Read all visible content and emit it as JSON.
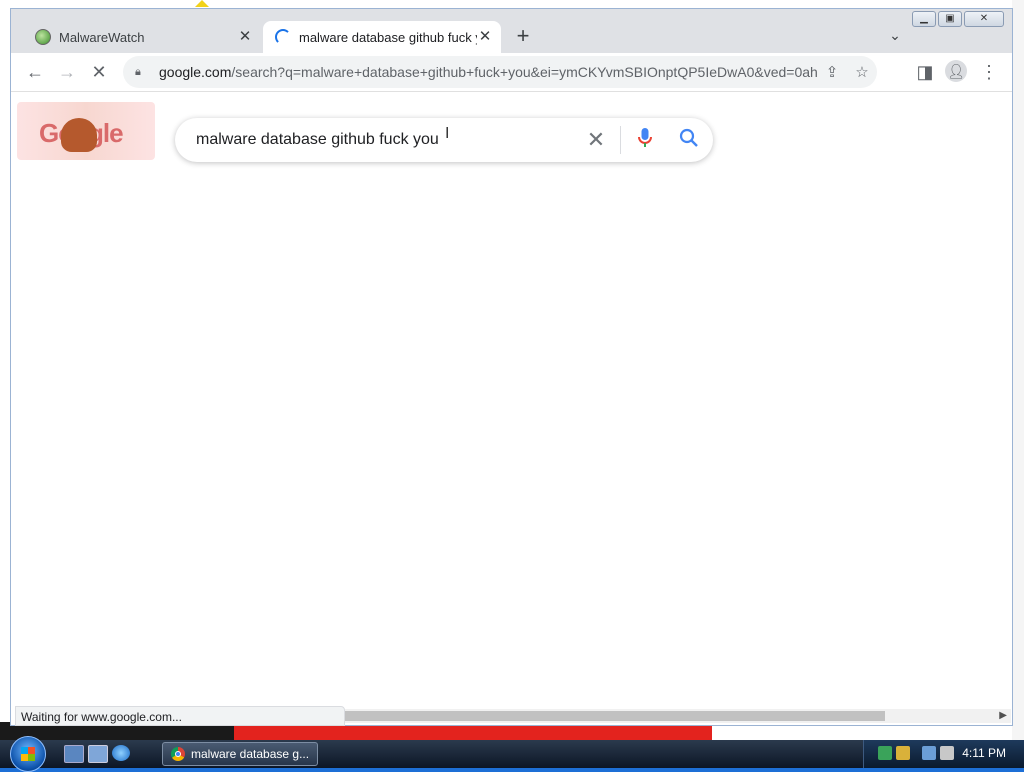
{
  "window": {
    "tabs": [
      {
        "title": "MalwareWatch",
        "active": false
      },
      {
        "title": "malware database github fuck yo",
        "active": true
      }
    ]
  },
  "toolbar": {
    "url_host": "google.com",
    "url_path": "/search?q=malware+database+github+fuck+you&ei=ymCKYvmSBIOnptQP5IeDwA0&ved=0ah..."
  },
  "page": {
    "doodle_text": "Google",
    "search_query": "malware database github fuck you",
    "status_text": "Waiting for www.google.com..."
  },
  "taskbar": {
    "task_label": "malware database g...",
    "clock": "4:11 PM"
  },
  "colors": {
    "accent": "#1a73e8",
    "mic_blue": "#4285f4",
    "mic_red": "#ea4335"
  }
}
